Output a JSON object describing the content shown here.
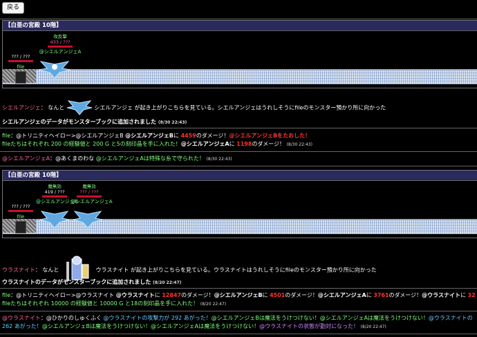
{
  "back_label": "戻る",
  "battle1": {
    "title": "【白亜の宮殿 10階】",
    "player": {
      "name": "file",
      "hp": "??? / ???",
      "hp_ratio": 1.0
    },
    "enemy": {
      "status": "攻反撃",
      "hp": "433 / ???",
      "name": "@シエルアンジェA",
      "hp_ratio": 0.8
    }
  },
  "log1": {
    "encounter_name": "シエルアンジェ",
    "encounter_pre": "： なんと",
    "encounter_post": "シエルアンジェ が起き上がりこちらを見ている。シエルアンジェはうれしそうにfileのモンスター預かり所に向かった",
    "book_line": "シエルアンジェのデータがモンスターブックに追加されました",
    "book_ts": "(8/30 22:43)",
    "atk_a": "file",
    "atk_b": "：@トリニティヘイロー>@シエルアンジェB",
    "atk_c": "@シエルアンジェB",
    "atk_d": "に",
    "atk_dmg1": "4459",
    "atk_e": "のダメージ！",
    "atk_kill": "@シエルアンジェBをたおした！",
    "reward_a": "fileたちはそれぞれ 200 の経験値と 200 G と5の刻印晶を手に入れた！",
    "reward_b": "@シエルアンジェA",
    "reward_c": "に",
    "reward_dmg": "1198",
    "reward_d": "のダメージ！",
    "reward_ts": "(8/30 22:43)",
    "speak_name": "@シエルアンジェA",
    "speak_text": "：@あくまのわな",
    "speak_effect": "@シエルアンジェAは特殊な糸で守られた！",
    "speak_ts": "(8/30 22:43)"
  },
  "battle2": {
    "title": "【白亜の宮殿 10階】",
    "player": {
      "name": "file",
      "hp": "??? / ???",
      "hp_ratio": 1.0
    },
    "enemies": [
      {
        "status": "魔無効",
        "hp": "419 / ???",
        "name": "@シエルアンジェB",
        "hp_ratio": 0.8
      },
      {
        "status": "魔無効",
        "hp": "??? / ???",
        "name": "@シエルアンジェA",
        "hp_ratio": 0.8
      }
    ]
  },
  "log2": {
    "encounter_name": "ウラスナイト",
    "encounter_pre": "： なんと",
    "encounter_post": "ウラスナイト が起き上がりこちらを見ている。ウラスナイトはうれしそうにfileのモンスター預かり所に向かった",
    "book_line": "ウラスナイトのデータがモンスターブックに追加されました",
    "book_ts": "(8/20 22:47)",
    "atk_a": "file",
    "atk_b": "：@トリニティヘイロー>@ウラスナイト",
    "atk_c": "@ウラスナイト",
    "atk_d": "に",
    "atk_dmg1": "12847",
    "atk_e": "のダメージ！",
    "atk_f": "@シエルアンジェB",
    "atk_g": "に",
    "atk_dmg2": "4501",
    "atk_h": "のダメージ！",
    "atk_i": "@シエルアンジェA",
    "atk_j": "に",
    "atk_dmg3": "3761",
    "atk_k": "のダメージ！",
    "atk_l": "@ウラスナイト",
    "atk_m": "に",
    "atk_dmg4": "32",
    "reward_a": "fileたちはそれぞれ 10000 の経験値と 10000 G と18の刻印晶を手に入れた！",
    "reward_ts": "(8/20 22:47)",
    "spell_name": "@ウラスナイト",
    "spell_text": "：@ひかりのしゅくふく",
    "spell_r1": "@ウラスナイトの攻撃力が 292 あがった！",
    "spell_r2": "@シエルアンジェBは魔法をうけつけない！",
    "spell_r3": "@シエルアンジェAは魔法をうけつけない！",
    "spell_r4": "@ウラスナイトの",
    "spell_l2_a": "262 あがった！",
    "spell_l2_b": "@シエルアンジェBは魔法をうけつけない！",
    "spell_l2_c": "@シエルアンジェAは魔法をうけつけない！",
    "spell_l2_d": "@ウラスナイトの状態が勤対になった！",
    "spell_ts": "(8/20 22:47)"
  }
}
